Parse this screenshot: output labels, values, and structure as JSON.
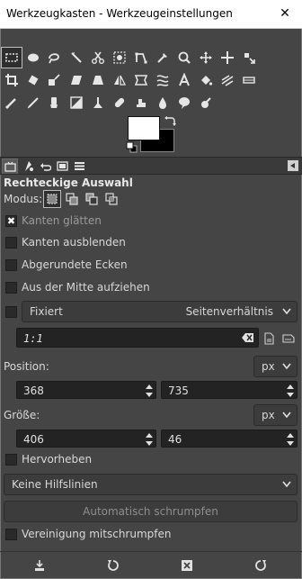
{
  "window": {
    "title": "Werkzeugkasten - Werkzeugeinstellungen",
    "close_glyph": "✕"
  },
  "toolbox": {
    "rows": [
      [
        "rect-select-icon",
        "ellipse-select-icon",
        "free-select-icon",
        "fuzzy-select-icon",
        "scissors-select-icon",
        "foreground-select-icon",
        "paths-icon",
        "color-picker-icon",
        "zoom-icon",
        "measure-icon",
        "move-icon",
        "alignment-icon"
      ],
      [
        "crop-icon",
        "rotate-icon",
        "scale-icon",
        "shear-icon",
        "perspective-icon",
        "flip-icon",
        "cage-icon",
        "warp-icon",
        "text-icon",
        "bucket-fill-icon",
        "gradient-icon",
        "pencil-icon"
      ],
      [
        "paintbrush-icon",
        "eraser-icon",
        "airbrush-icon",
        "ink-icon",
        "mypaint-brush-icon",
        "clone-icon",
        "heal-icon",
        "perspective-clone-icon",
        "blur-icon",
        "smudge-icon",
        "dodge-burn-icon"
      ]
    ],
    "active_tool": "rect-select-icon"
  },
  "colors": {
    "foreground": "#ffffff",
    "background": "#000000"
  },
  "dock": {
    "tabs": [
      "tool-options-tab-icon",
      "device-status-tab-icon",
      "undo-history-tab-icon",
      "images-tab-icon",
      "layers-tab-icon"
    ]
  },
  "options": {
    "section_title": "Rechteckige Auswahl",
    "mode_label": "Modus:",
    "antialias": {
      "label": "Kanten glätten",
      "checked": true,
      "mark": "✖"
    },
    "feather": {
      "label": "Kanten ausblenden",
      "checked": false
    },
    "rounded": {
      "label": "Abgerundete Ecken",
      "checked": false
    },
    "expand_center": {
      "label": "Aus der Mitte aufziehen",
      "checked": false
    },
    "fixed": {
      "label": "Fixiert",
      "value": "Seitenverhältnis",
      "checked": false
    },
    "ratio_value": "1:1",
    "position": {
      "label": "Position:",
      "unit": "px",
      "x": "368",
      "y": "735"
    },
    "size": {
      "label": "Größe:",
      "unit": "px",
      "w": "406",
      "h": "46"
    },
    "highlight": {
      "label": "Hervorheben",
      "checked": false
    },
    "guides": {
      "value": "Keine Hilfslinien"
    },
    "autoshrink_button": "Automatisch schrumpfen",
    "shrink_merged": {
      "label": "Vereinigung mitschrumpfen",
      "checked": false
    }
  },
  "bottom_bar": [
    "save-preset-icon",
    "restore-icon",
    "delete-icon",
    "reset-icon"
  ]
}
